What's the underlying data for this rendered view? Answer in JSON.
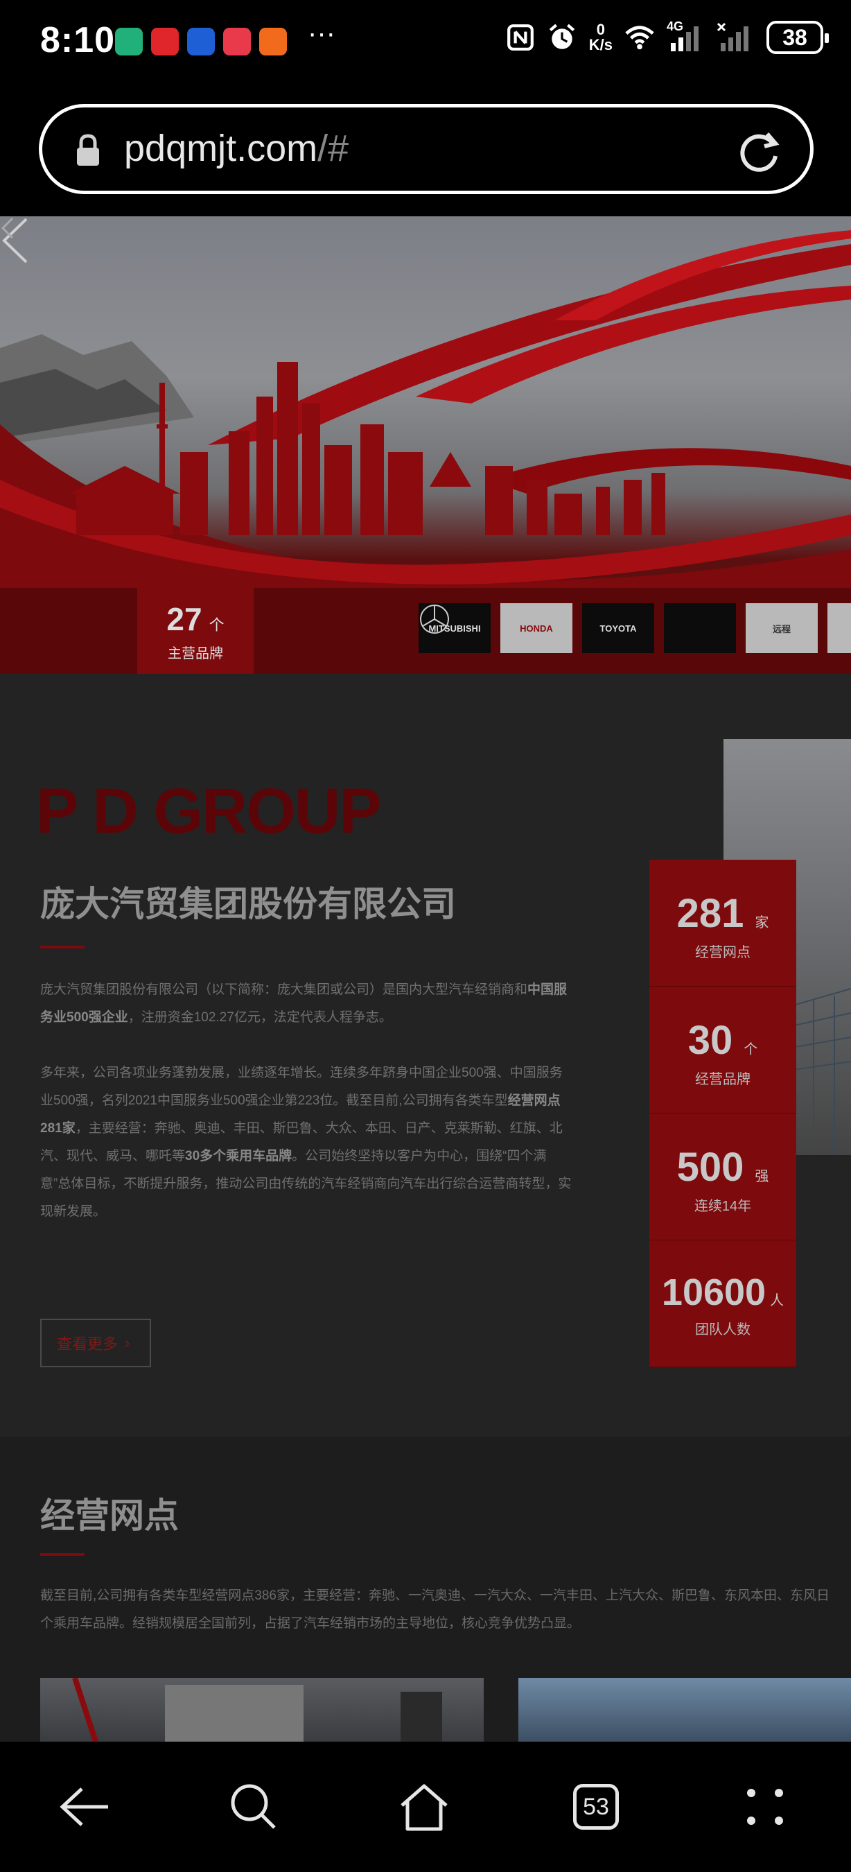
{
  "status_bar": {
    "time": "8:10",
    "more": "···",
    "net_speed_value": "0",
    "net_speed_unit": "K/s",
    "network": "4G",
    "battery": "38"
  },
  "browser": {
    "url_main": "pdqmjt.com",
    "url_hash": "/#",
    "tab_count": "53"
  },
  "hero": {
    "brand_count": "27",
    "brand_count_unit": "个",
    "brand_count_label": "主营品牌",
    "logos": [
      "MITSUBISHI",
      "HONDA",
      "TOYOTA",
      "Mercedes-Benz",
      "远程"
    ]
  },
  "about": {
    "en_title": "P D GROUP",
    "company_name": "庞大汽贸集团股份有限公司",
    "p1_a": "庞大汽贸集团股份有限公司（以下简称：庞大集团或公司）是国内大型汽车经销商和",
    "p1_b": "中国服务业500强企业",
    "p1_c": "，注册资金102.27亿元，法定代表人程争志。",
    "p2_a": "多年来，公司各项业务蓬勃发展，业绩逐年增长。连续多年跻身中国企业500强、中国服务业500强，名列2021中国服务业500强企业第223位。截至目前,公司拥有各类车型",
    "p2_b": "经营网点281家",
    "p2_c": "，主要经营：奔驰、奥迪、丰田、斯巴鲁、大众、本田、日产、克莱斯勒、红旗、北汽、现代、威马、哪吒等",
    "p2_d": "30多个乘用车品牌",
    "p2_e": "。公司始终坚持以客户为中心，围绕“四个满意”总体目标，不断提升服务，推动公司由传统的汽车经销商向汽车出行综合运营商转型，实现新发展。",
    "more_label": "查看更多",
    "more_arrow": "›",
    "stats": [
      {
        "value": "281",
        "unit": "家",
        "label": "经营网点"
      },
      {
        "value": "30",
        "unit": "个",
        "label": "经营品牌"
      },
      {
        "value": "500",
        "unit": "强",
        "label": "连续14年"
      },
      {
        "value": "10600",
        "unit": "人",
        "label": "团队人数"
      }
    ]
  },
  "outlets": {
    "title": "经营网点",
    "desc_line1": "截至目前,公司拥有各类车型经营网点386家，主要经营：奔驰、一汽奥迪、一汽大众、一汽丰田、上汽大众、斯巴鲁、东风本田、东风日",
    "desc_line2": "个乘用车品牌。经销规模居全国前列，占据了汽车经销市场的主导地位，核心竞争优势凸显。"
  },
  "colors": {
    "brand_red": "#7d0a0d",
    "background": "#222222"
  }
}
